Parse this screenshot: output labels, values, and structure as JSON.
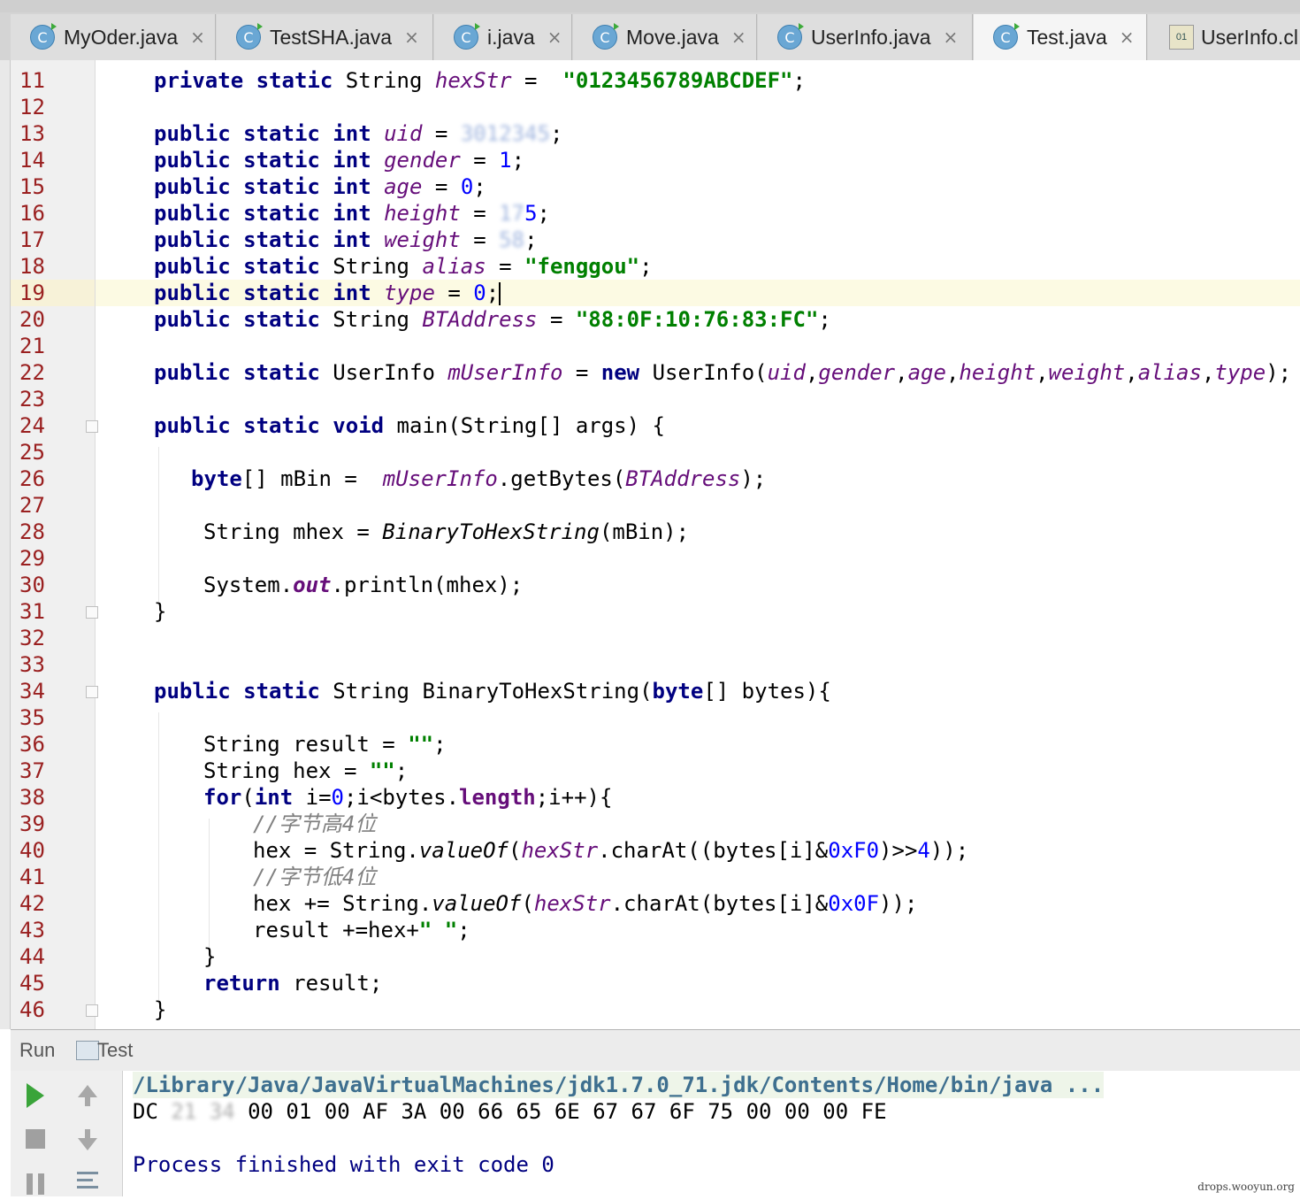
{
  "tabs": [
    {
      "label": "MyOder.java",
      "close": "×"
    },
    {
      "label": "TestSHA.java",
      "close": "×"
    },
    {
      "label": "i.java",
      "close": "×"
    },
    {
      "label": "Move.java",
      "close": "×"
    },
    {
      "label": "UserInfo.java",
      "close": "×"
    },
    {
      "label": "Test.java",
      "close": "×",
      "active": true
    },
    {
      "label": "UserInfo.cl"
    }
  ],
  "icons": {
    "class_icon": "C",
    "object_icon": "01"
  },
  "line_numbers": [
    "11",
    "12",
    "13",
    "14",
    "15",
    "16",
    "17",
    "18",
    "19",
    "20",
    "21",
    "22",
    "23",
    "24",
    "25",
    "26",
    "27",
    "28",
    "29",
    "30",
    "31",
    "32",
    "33",
    "34",
    "35",
    "36",
    "37",
    "38",
    "39",
    "40",
    "41",
    "42",
    "43",
    "44",
    "45",
    "46"
  ],
  "code": {
    "l11": {
      "kw": "private static",
      "type": "String",
      "field": "hexStr",
      "eq": " = ",
      "val": "\"0123456789ABCDEF\"",
      "end": ";"
    },
    "l13": {
      "kw": "public static int",
      "field": "uid",
      "eq": " = ",
      "val": "3",
      "blurred": "3012345",
      "end": ";"
    },
    "l14": {
      "kw": "public static int",
      "field": "gender",
      "eq": " = ",
      "val": "1",
      "end": ";"
    },
    "l15": {
      "kw": "public static int",
      "field": "age",
      "eq": " = ",
      "val": "0",
      "end": ";"
    },
    "l16": {
      "kw": "public static int",
      "field": "height",
      "eq": " = ",
      "blurred": "17",
      "val": "5",
      "end": ";"
    },
    "l17": {
      "kw": "public static int",
      "field": "weight",
      "eq": " = ",
      "blurred": "58",
      "end": ";"
    },
    "l18": {
      "kw": "public static",
      "type": "String",
      "field": "alias",
      "eq": " = ",
      "val": "\"fenggou\"",
      "end": ";"
    },
    "l19": {
      "kw": "public static int",
      "field": "type",
      "eq": " = ",
      "val": "0",
      "end": ";"
    },
    "l20": {
      "kw": "public static",
      "type": "String",
      "field": "BTAddress",
      "eq": " = ",
      "val": "\"88:0F:10:76:83:FC\"",
      "end": ";"
    },
    "l22": {
      "kw": "public static",
      "type": "UserInfo",
      "field": "mUserInfo",
      "eq": " = ",
      "new": "new",
      "ctor": "UserInfo(",
      "args": [
        "uid",
        "gender",
        "age",
        "height",
        "weight",
        "alias",
        "type"
      ],
      "end": ");"
    },
    "l24": {
      "kw": "public static void",
      "rest": "main(String[] args) {"
    },
    "l26": {
      "kw": "byte",
      "rest": "[] mBin =  ",
      "field": "mUserInfo",
      "call": ".getBytes(",
      "arg": "BTAddress",
      "end": ");"
    },
    "l28": {
      "pre": "String mhex = ",
      "static": "BinaryToHexString",
      "end": "(mBin);"
    },
    "l30": {
      "pre": "System.",
      "out": "out",
      "end": ".println(mhex);"
    },
    "l31": {
      "text": "}"
    },
    "l34": {
      "kw": "public static",
      "mid": "String BinaryToHexString(",
      "kw2": "byte",
      "end": "[] bytes){"
    },
    "l36": {
      "pre": "String result = ",
      "val": "\"\"",
      "end": ";"
    },
    "l37": {
      "pre": "String hex = ",
      "val": "\"\"",
      "end": ";"
    },
    "l38": {
      "kw": "for",
      "a": "(",
      "kw2": "int",
      "b": " i=",
      "n": "0",
      "c": ";i<bytes.",
      "len": "length",
      "d": ";i++){"
    },
    "l39": {
      "comment": "//字节高4位"
    },
    "l40": {
      "pre": "hex = String.",
      "static": "valueOf",
      "a": "(",
      "field": "hexStr",
      "b": ".charAt((bytes[i]&",
      "n1": "0xF0",
      "c": ")>>",
      "n2": "4",
      "end": "));"
    },
    "l41": {
      "comment": "//字节低4位"
    },
    "l42": {
      "pre": "hex += String.",
      "static": "valueOf",
      "a": "(",
      "field": "hexStr",
      "b": ".charAt(bytes[i]&",
      "n1": "0x0F",
      "end": "));"
    },
    "l43": {
      "pre": "result +=hex+",
      "val": "\" \"",
      "end": ";"
    },
    "l44": {
      "text": "}"
    },
    "l45": {
      "kw": "return",
      "rest": " result;"
    },
    "l46": {
      "text": "}"
    }
  },
  "run_panel": {
    "run_label": "Run",
    "config_label": "Test",
    "command": "/Library/Java/JavaVirtualMachines/jdk1.7.0_71.jdk/Contents/Home/bin/java ...",
    "output_prefix": "DC",
    "output_blurred": "21 34",
    "output_rest": "00 01 00 AF 3A 00 66 65 6E 67 67 6F 75 00 00 00 FE",
    "exit_message": "Process finished with exit code 0"
  },
  "watermark": "drops.wooyun.org",
  "colors": {
    "keyword": "#000080",
    "field": "#660e7a",
    "string": "#008000",
    "number": "#0000ff",
    "line_number": "#9a2020",
    "current_line": "#fcfae3"
  }
}
